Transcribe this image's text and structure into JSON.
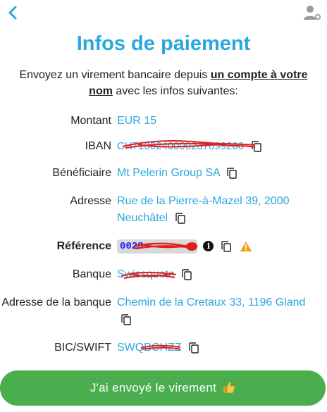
{
  "page": {
    "title": "Infos de paiement"
  },
  "intro": {
    "before": "Envoyez un virement bancaire depuis ",
    "emphasis": "un compte à votre nom",
    "after": " avec les infos suivantes:"
  },
  "fields": {
    "amount": {
      "label": "Montant",
      "value": "EUR 15"
    },
    "iban": {
      "label": "IBAN",
      "value": "CH7100240000237099200"
    },
    "beneficiary": {
      "label": "Bénéficiaire",
      "value": "Mt Pelerin Group SA"
    },
    "address": {
      "label": "Adresse",
      "value": "Rue de la Pierre-à-Mazel 39, 2000 Neuchâtel"
    },
    "reference": {
      "label": "Référence",
      "value": "002S"
    },
    "bank": {
      "label": "Banque",
      "value": "Swissquote"
    },
    "bank_address": {
      "label": "Adresse de la banque",
      "value": "Chemin de la Cretaux 33, 1196 Gland"
    },
    "bic": {
      "label": "BIC/SWIFT",
      "value": "SWQBCHZZ"
    }
  },
  "actions": {
    "submit_label": "J'ai envoyé le virement"
  },
  "icons": {
    "back": "chevron-left-icon",
    "user": "user-settings-icon",
    "copy": "copy-icon",
    "info": "info-icon",
    "warning": "warning-icon",
    "thumbs_up": "thumbs-up-icon"
  },
  "colors": {
    "accent": "#29a8e0",
    "link": "#2aa7de",
    "button": "#4aae4f",
    "warning": "#f39c12",
    "redaction": "#e02020"
  }
}
